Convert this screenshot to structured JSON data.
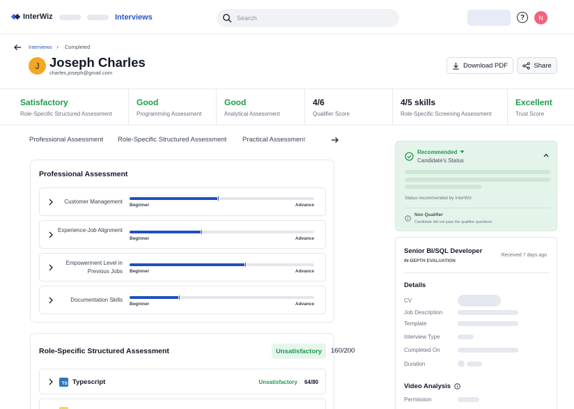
{
  "app": {
    "logo_text": "InterWiz",
    "nav_active": "Interviews",
    "search_placeholder": "Search",
    "user_initial": "N",
    "help_label": "?"
  },
  "breadcrumb": {
    "parent": "Interviews",
    "current": "Completed"
  },
  "candidate": {
    "initial": "J",
    "name": "Joseph Charles",
    "email": "charles.joseph@gmail.com"
  },
  "actions": {
    "download_label": "Download PDF",
    "share_label": "Share"
  },
  "scores": [
    {
      "value": "Satisfactory",
      "label": "Role-Specific Structured Assessment",
      "color": "#1f9a4d"
    },
    {
      "value": "Good",
      "label": "Programming Assessment",
      "color": "#1f9a4d"
    },
    {
      "value": "Good",
      "label": "Analytical Assessment",
      "color": "#1f9a4d"
    },
    {
      "value": "4/6",
      "label": "Qualifier Score",
      "color": "#111827"
    },
    {
      "value": "4/5 skills",
      "label": "Role-Specific Screening Assessment",
      "color": "#111827"
    },
    {
      "value": "Excellent",
      "label": "Trust Score",
      "color": "#1f9a4d"
    }
  ],
  "tabs": [
    "Professional Assessment",
    "Role-Specific Structured Assessment",
    "Practical Assessment"
  ],
  "professional": {
    "title": "Professional Assessment",
    "min_label": "Beginner",
    "max_label": "Advance",
    "skills": [
      {
        "name": "Customer Management",
        "level": 0.48
      },
      {
        "name": "Experience-Job Alignment",
        "level": 0.39
      },
      {
        "name": "Empowerment Level in Previous Jobs",
        "level": 0.63
      },
      {
        "name": "Documentation Skills",
        "level": 0.27
      }
    ]
  },
  "structured": {
    "title": "Role-Specific Structured Assessment",
    "status": "Unsatisfactory",
    "score": "160/200",
    "items": [
      {
        "name": "Typescript",
        "status": "Unsatisfactory",
        "score": "64/80",
        "icon_text": "TS"
      }
    ]
  },
  "recommendation": {
    "label": "Recommended",
    "sub": "Candidate's Status",
    "by": "Status recommended by InterWiz",
    "nq_title": "Non Qualifier",
    "nq_sub": "Candidate did not pass the qualifier questions"
  },
  "job": {
    "title": "Senior BI/SQL Developer",
    "received": "Received 7 days ago",
    "eval": "IN-DEPTH EVALUATION",
    "details_title": "Details",
    "details": [
      "CV",
      "Job Description",
      "Template",
      "Interview Type",
      "Completed On",
      "Duration"
    ],
    "video_title": "Video Analysis",
    "permission_label": "Permission"
  },
  "colors": {
    "accent": "#2a56c6",
    "bar": "#1f4fc4",
    "green": "#1f9a4d",
    "avatar": "#f5a623",
    "user_avatar": "#f2637e"
  }
}
